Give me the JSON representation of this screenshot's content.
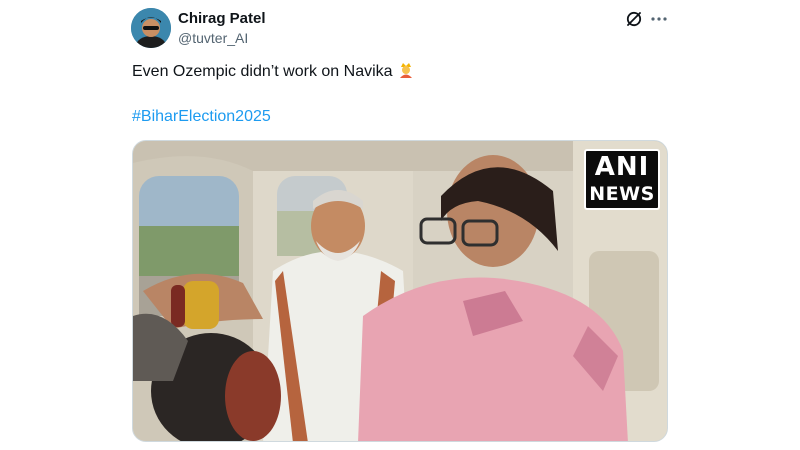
{
  "author": {
    "display_name": "Chirag Patel",
    "handle": "@tuvter_AI",
    "avatar": "avatar-photo"
  },
  "actions": {
    "grok_icon": "grok-icon",
    "more_icon": "more-options-icon"
  },
  "post": {
    "text": "Even Ozempic didn’t work on Navika",
    "emoji": "person-with-crown-emoji",
    "hashtag": "#BiharElection2025"
  },
  "media": {
    "type": "video-frame",
    "watermark_line1": "ANI",
    "watermark_line2": "NEWS"
  },
  "colors": {
    "text_primary": "#0f1419",
    "text_secondary": "#536471",
    "link": "#1d9bf0",
    "border": "#cfd9de"
  }
}
